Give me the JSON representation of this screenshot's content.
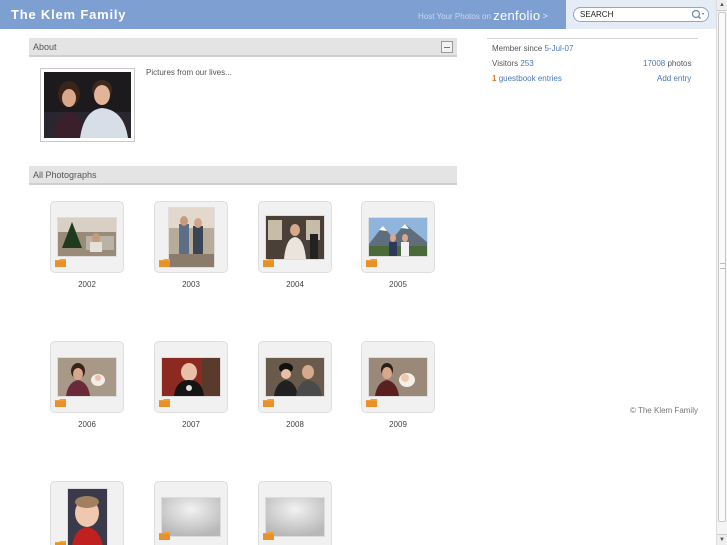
{
  "site": {
    "title": "The Klem Family"
  },
  "promo": {
    "prefix": "Host Your Photos on",
    "logo": "zenfolio",
    "arrow": ">"
  },
  "search": {
    "placeholder": "SEARCH"
  },
  "about": {
    "heading": "About",
    "description": "Pictures from our lives..."
  },
  "gallery": {
    "heading": "All Photographs",
    "folders": [
      {
        "label": "2002"
      },
      {
        "label": "2003"
      },
      {
        "label": "2004"
      },
      {
        "label": "2005"
      },
      {
        "label": "2006"
      },
      {
        "label": "2007"
      },
      {
        "label": "2008"
      },
      {
        "label": "2009"
      },
      {
        "label": ""
      },
      {
        "label": ""
      },
      {
        "label": ""
      }
    ]
  },
  "sidebar": {
    "member_since_label": "Member since",
    "member_since_value": "5-Jul-07",
    "visitors_label": "Visitors",
    "visitors_value": "253",
    "photos_count": "17008",
    "photos_label": "photos",
    "guestbook_count": "1",
    "guestbook_label": "guestbook entries",
    "add_entry": "Add entry"
  },
  "footer": {
    "copyright": "© The Klem Family"
  },
  "colors": {
    "topbar": "#7d9fd2",
    "link": "#4a78b8",
    "accent": "#e0782c",
    "folder": "#f0a030"
  }
}
